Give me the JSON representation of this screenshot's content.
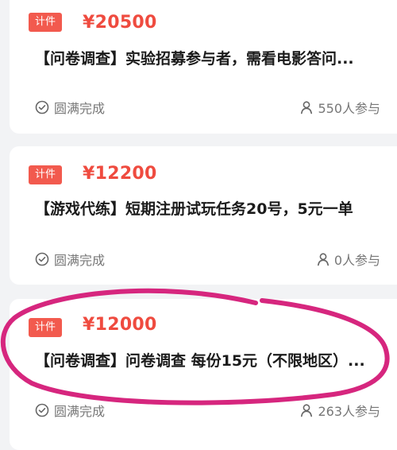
{
  "tasks": [
    {
      "tag": "计件",
      "price": "¥20500",
      "title": "【问卷调查】实验招募参与者，需看电影答问...",
      "status": "圆满完成",
      "participants": "550人参与"
    },
    {
      "tag": "计件",
      "price": "¥12200",
      "title": "【游戏代练】短期注册试玩任务20号，5元一单",
      "status": "圆满完成",
      "participants": "0人参与"
    },
    {
      "tag": "计件",
      "price": "¥12000",
      "title": "【问卷调查】问卷调查 每份15元（不限地区）...",
      "status": "圆满完成",
      "participants": "263人参与"
    }
  ],
  "colors": {
    "accent": "#ef4b3f",
    "tag_bg": "#f25a4e",
    "annotation": "#d6267e"
  },
  "icons": {
    "status": "check-circle-icon",
    "participants": "person-icon"
  }
}
